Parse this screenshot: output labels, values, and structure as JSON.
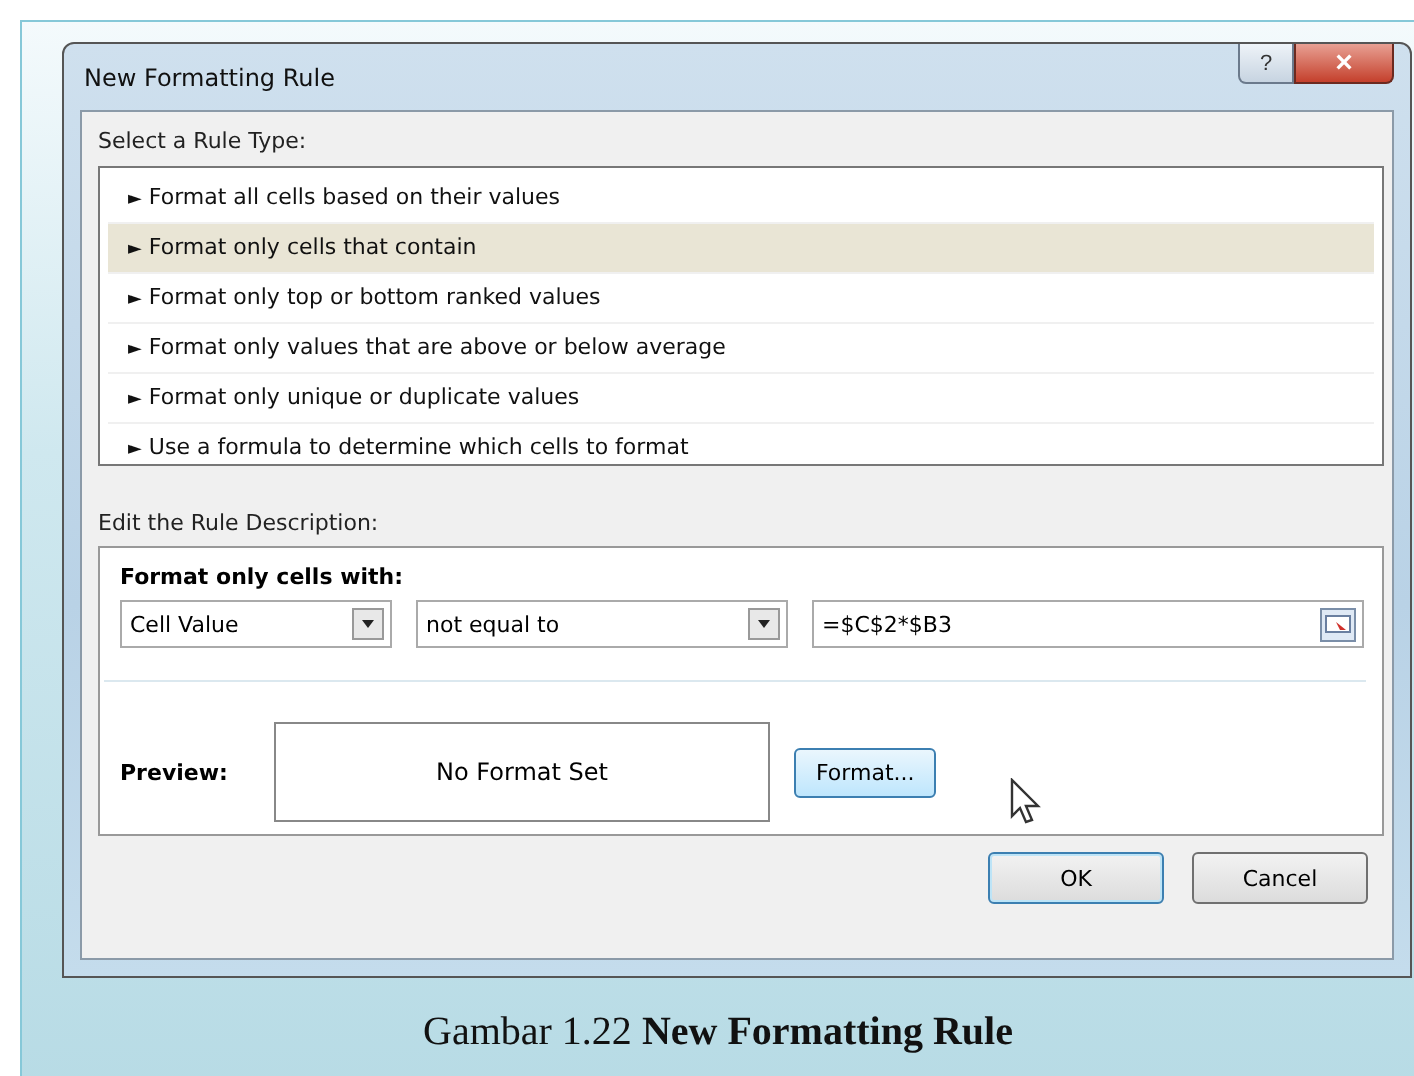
{
  "window": {
    "title": "New Formatting Rule",
    "help": "?",
    "close": "×"
  },
  "rule_type": {
    "label": "Select a Rule Type:",
    "items": [
      {
        "marker": "►",
        "label": "Format all cells based on their values",
        "selected": false
      },
      {
        "marker": "►",
        "label": "Format only cells that contain",
        "selected": true
      },
      {
        "marker": "►",
        "label": "Format only top or bottom ranked values",
        "selected": false
      },
      {
        "marker": "►",
        "label": "Format only values that are above or below average",
        "selected": false
      },
      {
        "marker": "►",
        "label": "Format only unique or duplicate values",
        "selected": false
      },
      {
        "marker": "►",
        "label": "Use a formula to determine which cells to format",
        "selected": false
      }
    ]
  },
  "description": {
    "label": "Edit the Rule Description:",
    "heading": "Format only cells with:",
    "condition_type": "Cell Value",
    "operator": "not equal to",
    "formula": "=$C$2*$B3",
    "preview_label": "Preview:",
    "preview": "No Format Set",
    "format_button": "Format..."
  },
  "buttons": [
    "OK",
    "Cancel"
  ],
  "caption": "Gambar 1.22 **New Formatting Rule**"
}
